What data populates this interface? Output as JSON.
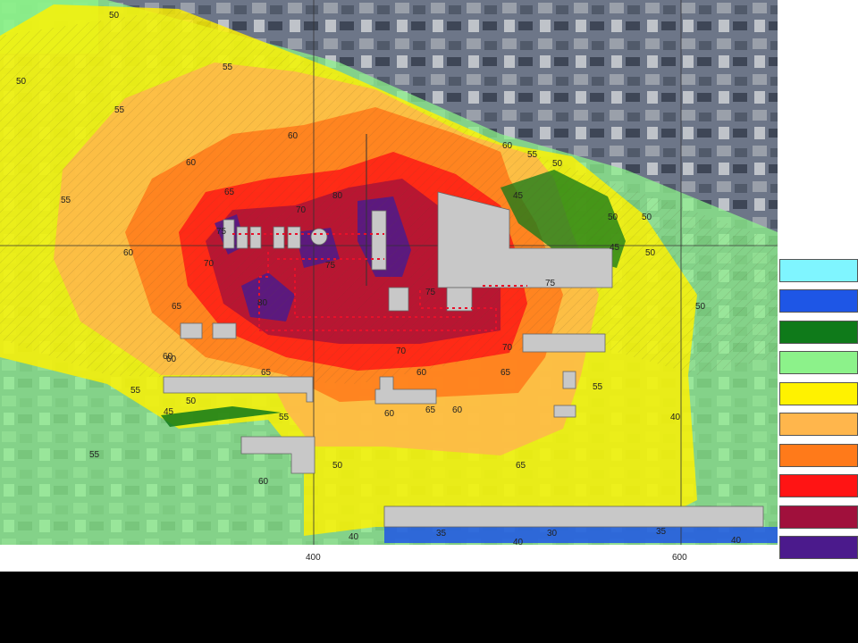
{
  "map": {
    "x_axis_ticks": [
      "400",
      "600"
    ],
    "contour_labels": [
      "50",
      "55",
      "50",
      "55",
      "60",
      "60",
      "60",
      "65",
      "70",
      "75",
      "80",
      "55",
      "60",
      "65",
      "70",
      "75",
      "80",
      "60",
      "65",
      "70",
      "75",
      "45",
      "50",
      "55",
      "60",
      "65",
      "70",
      "75",
      "50",
      "55",
      "60",
      "65",
      "50",
      "45",
      "50",
      "55",
      "60",
      "45",
      "50",
      "55",
      "60",
      "65",
      "50",
      "55",
      "60",
      "50",
      "40",
      "40",
      "35",
      "40",
      "30",
      "35",
      "40"
    ]
  },
  "legend": {
    "colors": [
      "#7ff5ff",
      "#1e56e6",
      "#0f7a1a",
      "#8cf28a",
      "#fff200",
      "#ffb64c",
      "#ff7a1a",
      "#ff1414",
      "#a0103c",
      "#4b1a8c"
    ]
  }
}
